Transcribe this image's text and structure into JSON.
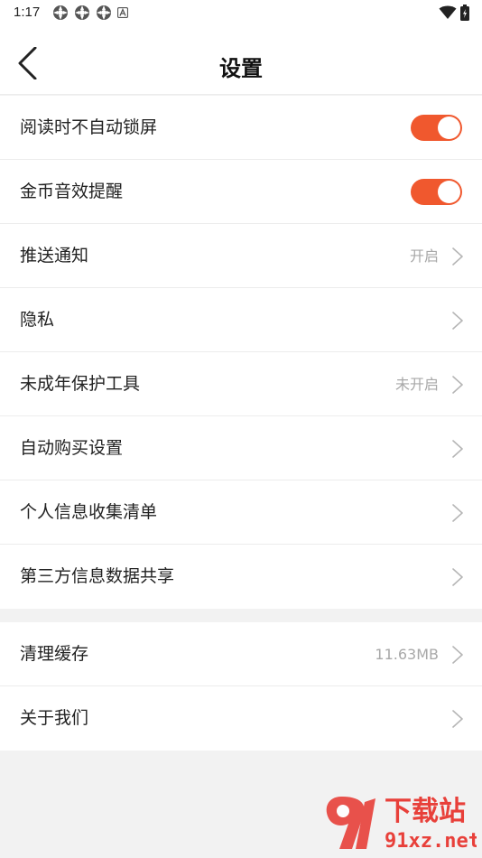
{
  "status_bar": {
    "time": "1:17",
    "icons_left": [
      "app-icon",
      "app-icon",
      "app-icon",
      "a-icon"
    ],
    "icons_right": [
      "wifi-icon",
      "battery-icon"
    ]
  },
  "header": {
    "title": "设置",
    "back_icon": "chevron-left-icon"
  },
  "settings_group_1": [
    {
      "label": "阅读时不自动锁屏",
      "type": "toggle",
      "on": true
    },
    {
      "label": "金币音效提醒",
      "type": "toggle",
      "on": true
    },
    {
      "label": "推送通知",
      "type": "link",
      "value": "开启"
    },
    {
      "label": "隐私",
      "type": "link",
      "value": ""
    },
    {
      "label": "未成年保护工具",
      "type": "link",
      "value": "未开启"
    },
    {
      "label": "自动购买设置",
      "type": "link",
      "value": ""
    },
    {
      "label": "个人信息收集清单",
      "type": "link",
      "value": ""
    },
    {
      "label": "第三方信息数据共享",
      "type": "link",
      "value": ""
    }
  ],
  "settings_group_2": [
    {
      "label": "清理缓存",
      "type": "link",
      "value": "11.63MB"
    },
    {
      "label": "关于我们",
      "type": "link",
      "value": ""
    }
  ],
  "watermark": {
    "logo_icon": "91xz-logo-icon",
    "text_top": "下载站",
    "text_bottom": "91xz.net"
  },
  "colors": {
    "accent": "#f0582e",
    "background": "#f2f2f2",
    "card": "#ffffff",
    "secondary_text": "#a8a8a8"
  }
}
